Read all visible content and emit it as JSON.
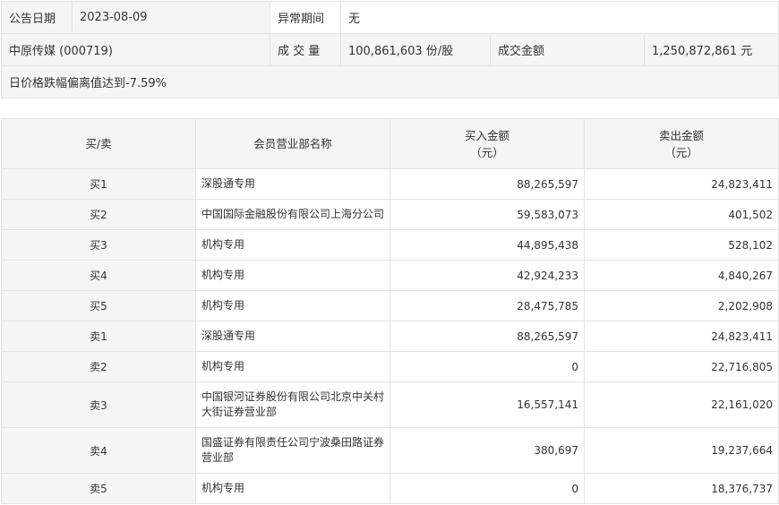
{
  "info": {
    "date_label": "公告日期",
    "date_value": "2023-08-09",
    "period_label": "异常期间",
    "period_value": "无",
    "stock_name": "中原传媒 (000719)",
    "volume_label": "成 交 量",
    "volume_value": "100,861,603 份/股",
    "amount_label": "成交金额",
    "amount_value": "1,250,872,861 元",
    "reason": "日价格跌幅偏离值达到-7.59%"
  },
  "trades": {
    "headers": {
      "side": "买/卖",
      "branch": "会员营业部名称",
      "buy_line1": "买入金额",
      "buy_line2": "（元）",
      "sell_line1": "卖出金额",
      "sell_line2": "（元）"
    },
    "rows": [
      {
        "side": "买1",
        "branch": "深股通专用",
        "buy": "88,265,597",
        "sell": "24,823,411"
      },
      {
        "side": "买2",
        "branch": "中国国际金融股份有限公司上海分公司",
        "buy": "59,583,073",
        "sell": "401,502"
      },
      {
        "side": "买3",
        "branch": "机构专用",
        "buy": "44,895,438",
        "sell": "528,102"
      },
      {
        "side": "买4",
        "branch": "机构专用",
        "buy": "42,924,233",
        "sell": "4,840,267"
      },
      {
        "side": "买5",
        "branch": "机构专用",
        "buy": "28,475,785",
        "sell": "2,202,908"
      },
      {
        "side": "卖1",
        "branch": "深股通专用",
        "buy": "88,265,597",
        "sell": "24,823,411"
      },
      {
        "side": "卖2",
        "branch": "机构专用",
        "buy": "0",
        "sell": "22,716,805"
      },
      {
        "side": "卖3",
        "branch": "中国银河证券股份有限公司北京中关村大街证券营业部",
        "buy": "16,557,141",
        "sell": "22,161,020"
      },
      {
        "side": "卖4",
        "branch": "国盛证券有限责任公司宁波桑田路证券营业部",
        "buy": "380,697",
        "sell": "19,237,664"
      },
      {
        "side": "卖5",
        "branch": "机构专用",
        "buy": "0",
        "sell": "18,376,737"
      }
    ]
  }
}
